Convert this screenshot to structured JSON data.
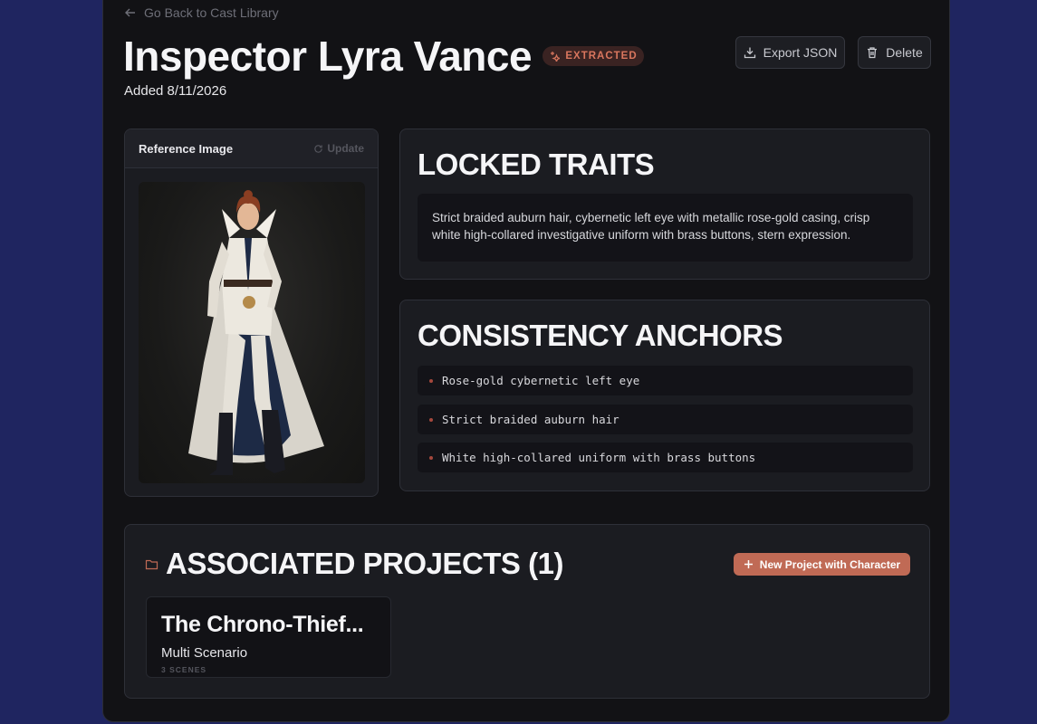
{
  "nav": {
    "back_label": "Go Back to Cast Library"
  },
  "character": {
    "name": "Inspector Lyra Vance",
    "status_badge": "EXTRACTED",
    "added_label": "Added 8/11/2026"
  },
  "actions": {
    "export_label": "Export JSON",
    "delete_label": "Delete"
  },
  "reference": {
    "title": "Reference Image",
    "update_label": "Update"
  },
  "locked_traits": {
    "heading": "LOCKED TRAITS",
    "text": "Strict braided auburn hair, cybernetic left eye with metallic rose-gold casing, crisp white high-collared investigative uniform with brass buttons, stern expression."
  },
  "anchors": {
    "heading": "CONSISTENCY ANCHORS",
    "items": [
      "Rose-gold cybernetic left eye",
      "Strict braided auburn hair",
      "White high-collared uniform with brass buttons"
    ]
  },
  "projects": {
    "heading": "ASSOCIATED PROJECTS (1)",
    "new_button_label": "New Project with Character",
    "items": [
      {
        "name": "The Chrono-Thief...",
        "type": "Multi Scenario",
        "scenes": "3 SCENES"
      }
    ]
  },
  "colors": {
    "background": "#1f2560",
    "panel": "#121215",
    "accent": "#c06a55",
    "badge_text": "#d9765e"
  },
  "icons": {
    "back": "arrow-left-icon",
    "badge": "sparkles-icon",
    "export": "download-icon",
    "delete": "trash-icon",
    "update": "refresh-icon",
    "projects": "folder-icon",
    "new": "plus-icon"
  }
}
